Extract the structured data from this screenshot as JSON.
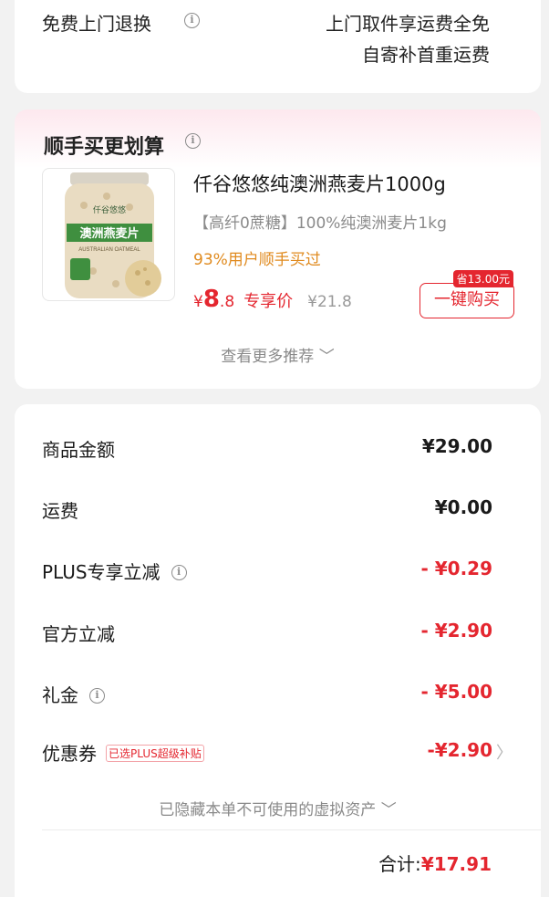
{
  "return_card": {
    "label": "免费上门退换",
    "line1": "上门取件享运费全免",
    "line2": "自寄补首重运费"
  },
  "bundle": {
    "title": "顺手买更划算",
    "product": {
      "title": "仟谷悠悠纯澳洲燕麦片1000g",
      "subtitle": "【高纤0蔗糖】100%纯澳洲麦片1kg",
      "bought": "93%用户顺手买过",
      "price_yen": "¥",
      "price_int": "8",
      "price_dec": ".8",
      "price_tag": "专享价",
      "price_orig": "¥21.8",
      "save_badge": "省13.00元",
      "buy_button": "一键购买",
      "pack_brand": "仟谷悠悠",
      "pack_name": "澳洲燕麦片",
      "pack_sub": "AUSTRALIAN OATMEAL"
    },
    "more": "查看更多推荐 ﹀"
  },
  "summary": {
    "rows": [
      {
        "label": "商品金额",
        "value": "¥29.00"
      },
      {
        "label": "运费",
        "value": "¥0.00"
      },
      {
        "label": "PLUS专享立减",
        "value": "- ¥0.29"
      },
      {
        "label": "官方立减",
        "value": "- ¥2.90"
      },
      {
        "label": "礼金",
        "value": "- ¥5.00"
      },
      {
        "label": "优惠券",
        "value": "-¥2.90",
        "tag": "已选PLUS超级补贴",
        "chevron": "〉"
      }
    ],
    "hidden_assets": "已隐藏本单不可使用的虚拟资产 ﹀",
    "total_label": "合计:",
    "total_value": "¥17.91"
  },
  "colors": {
    "accent_red": "#e4262f",
    "orange": "#e08a1e",
    "muted": "#8a8a8a"
  },
  "icons": {
    "info": "info-circle-icon",
    "chevron_right": "chevron-right-icon"
  }
}
